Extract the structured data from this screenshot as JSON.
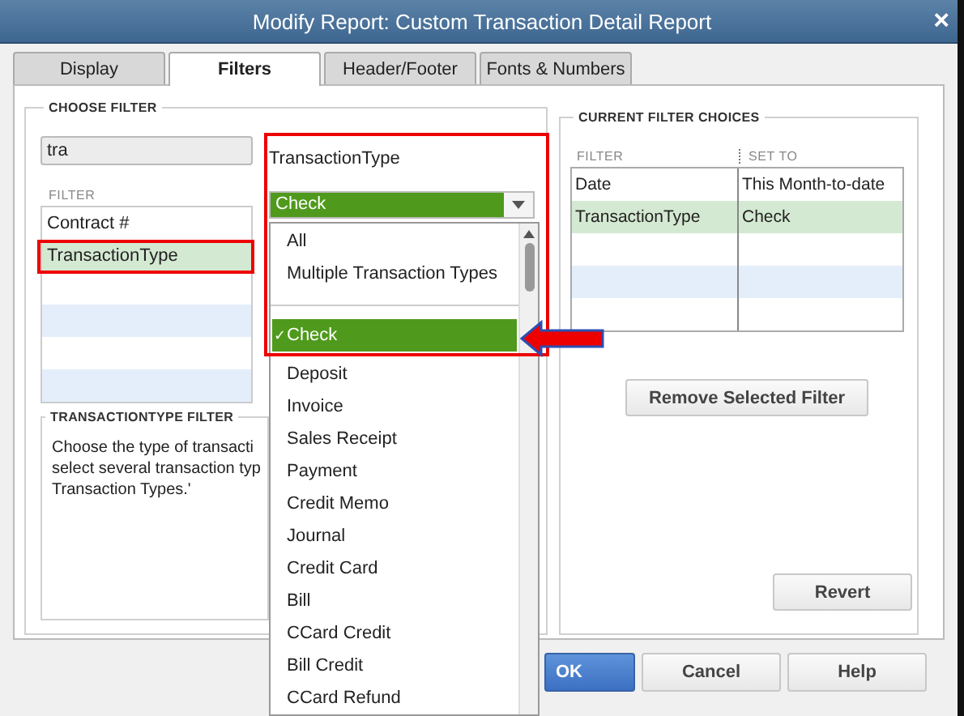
{
  "window": {
    "title": "Modify Report: Custom Transaction Detail Report",
    "close": "×"
  },
  "tabs": [
    {
      "label": "Display",
      "selected": false
    },
    {
      "label": "Filters",
      "selected": true
    },
    {
      "label": "Header/Footer",
      "selected": false
    },
    {
      "label": "Fonts & Numbers",
      "selected": false
    }
  ],
  "choose_filter": {
    "title": "CHOOSE FILTER",
    "search": {
      "value": "tra"
    },
    "list_header": "FILTER",
    "filters": [
      {
        "label": "Contract #",
        "selected": false
      },
      {
        "label": "TransactionType",
        "selected": true
      }
    ],
    "detail": {
      "label": "TransactionType",
      "value": "Check"
    },
    "help": {
      "title": "TRANSACTIONTYPE FILTER",
      "text": "Choose the type of transacti\nselect several transaction typ\nTransaction Types.'"
    }
  },
  "dropdown": {
    "items": [
      {
        "kind": "option",
        "label": "All",
        "selected": false
      },
      {
        "kind": "option",
        "label": "Multiple Transaction Types",
        "selected": false
      },
      {
        "kind": "separator"
      },
      {
        "kind": "option",
        "label": "Check",
        "selected": true
      },
      {
        "kind": "option",
        "label": "Deposit",
        "selected": false
      },
      {
        "kind": "option",
        "label": "Invoice",
        "selected": false
      },
      {
        "kind": "option",
        "label": "Sales Receipt",
        "selected": false
      },
      {
        "kind": "option",
        "label": "Payment",
        "selected": false
      },
      {
        "kind": "option",
        "label": "Credit Memo",
        "selected": false
      },
      {
        "kind": "option",
        "label": "Journal",
        "selected": false
      },
      {
        "kind": "option",
        "label": "Credit Card",
        "selected": false
      },
      {
        "kind": "option",
        "label": "Bill",
        "selected": false
      },
      {
        "kind": "option",
        "label": "CCard Credit",
        "selected": false
      },
      {
        "kind": "option",
        "label": "Bill Credit",
        "selected": false
      },
      {
        "kind": "option",
        "label": "CCard Refund",
        "selected": false
      }
    ],
    "check_mark": "✓"
  },
  "current_filters": {
    "title": "CURRENT FILTER CHOICES",
    "columns": [
      "FILTER",
      "SET TO"
    ],
    "rows": [
      {
        "filter": "Date",
        "set_to": "This Month-to-date",
        "selected": false
      },
      {
        "filter": "TransactionType",
        "set_to": "Check",
        "selected": true
      }
    ],
    "remove_button": "Remove Selected Filter"
  },
  "revert_button": "Revert",
  "buttons": [
    {
      "label": "OK",
      "kind": "primary"
    },
    {
      "label": "Cancel",
      "kind": "normal"
    },
    {
      "label": "Help",
      "kind": "normal"
    }
  ]
}
